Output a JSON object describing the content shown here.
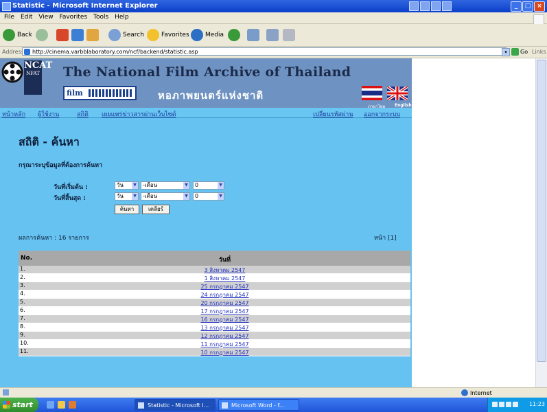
{
  "window": {
    "title": "Statistic - Microsoft Internet Explorer",
    "controls": {
      "minimize": "_",
      "maximize": "□",
      "close": "×"
    }
  },
  "menubar": {
    "items": [
      "File",
      "Edit",
      "View",
      "Favorites",
      "Tools",
      "Help"
    ]
  },
  "toolbar": {
    "back": "Back",
    "search": "Search",
    "favorites": "Favorites",
    "media": "Media"
  },
  "address": {
    "label": "Address",
    "url": "http://cinema.varbblaboratory.com/ncf/backend/statistic.asp",
    "go": "Go",
    "links": "Links"
  },
  "site": {
    "org_abbr": "NCAT",
    "org_abbr_sub": "NFAT",
    "org_name_en": "The National Film Archive of Thailand",
    "org_name_th": "หอภาพยนตร์แห่งชาติ",
    "film_logo_text": "film",
    "lang_th": "ภาษาไทย",
    "lang_en": "English"
  },
  "nav": {
    "left": [
      "หน้าหลัก",
      "ผู้ใช้งาน",
      "สถิติ",
      "เผยแพร่ข่าวสารผ่านเว็บไซต์"
    ],
    "right": [
      "เปลี่ยนรหัสผ่าน",
      "ออกจากระบบ"
    ]
  },
  "page": {
    "title": "สถิติ - ค้นหา",
    "instructions": "กรุณาระบุข้อมูลที่ต้องการค้นหา"
  },
  "search_form": {
    "start_label": "วันที่เริ่มต้น :",
    "end_label": "วันที่สิ้นสุด :",
    "day_value": "วัน",
    "month_value": "-เดือน",
    "year_value": "0",
    "search_button": "ค้นหา",
    "reset_button": "เคลียร์"
  },
  "results": {
    "count_text": "ผลการค้นหา : 16 รายการ",
    "pager_text": "หน้า [1]",
    "columns": [
      "No.",
      "วันที่"
    ],
    "rows": [
      {
        "no": "1.",
        "date": "3 สิงหาคม 2547"
      },
      {
        "no": "2.",
        "date": "1 สิงหาคม 2547"
      },
      {
        "no": "3.",
        "date": "25 กรกฎาคม 2547"
      },
      {
        "no": "4.",
        "date": "24 กรกฎาคม 2547"
      },
      {
        "no": "5.",
        "date": "20 กรกฎาคม 2547"
      },
      {
        "no": "6.",
        "date": "17 กรกฎาคม 2547"
      },
      {
        "no": "7.",
        "date": "16 กรกฎาคม 2547"
      },
      {
        "no": "8.",
        "date": "13 กรกฎาคม 2547"
      },
      {
        "no": "9.",
        "date": "12 กรกฎาคม 2547"
      },
      {
        "no": "10.",
        "date": "11 กรกฎาคม 2547"
      },
      {
        "no": "11.",
        "date": "10 กรกฎาคม 2547"
      }
    ]
  },
  "statusbar": {
    "zone": "Internet"
  },
  "taskbar": {
    "start": "start",
    "tasks": [
      "Statistic - Microsoft I...",
      "Microsoft Word - f..."
    ],
    "clock": "11:23"
  },
  "colors": {
    "page_background": "#66c3f1",
    "banner": "#6e93c2",
    "table_header": "#a8a8a8",
    "link": "#1e2fc0"
  },
  "icons": [
    "ie-icon",
    "back-icon",
    "forward-icon",
    "stop-icon",
    "refresh-icon",
    "home-icon",
    "search-icon",
    "favorites-icon",
    "media-icon",
    "history-icon",
    "mail-icon",
    "print-icon",
    "edit-icon",
    "film-reel-logo-icon",
    "thai-flag-icon",
    "uk-flag-icon",
    "internet-zone-icon"
  ]
}
